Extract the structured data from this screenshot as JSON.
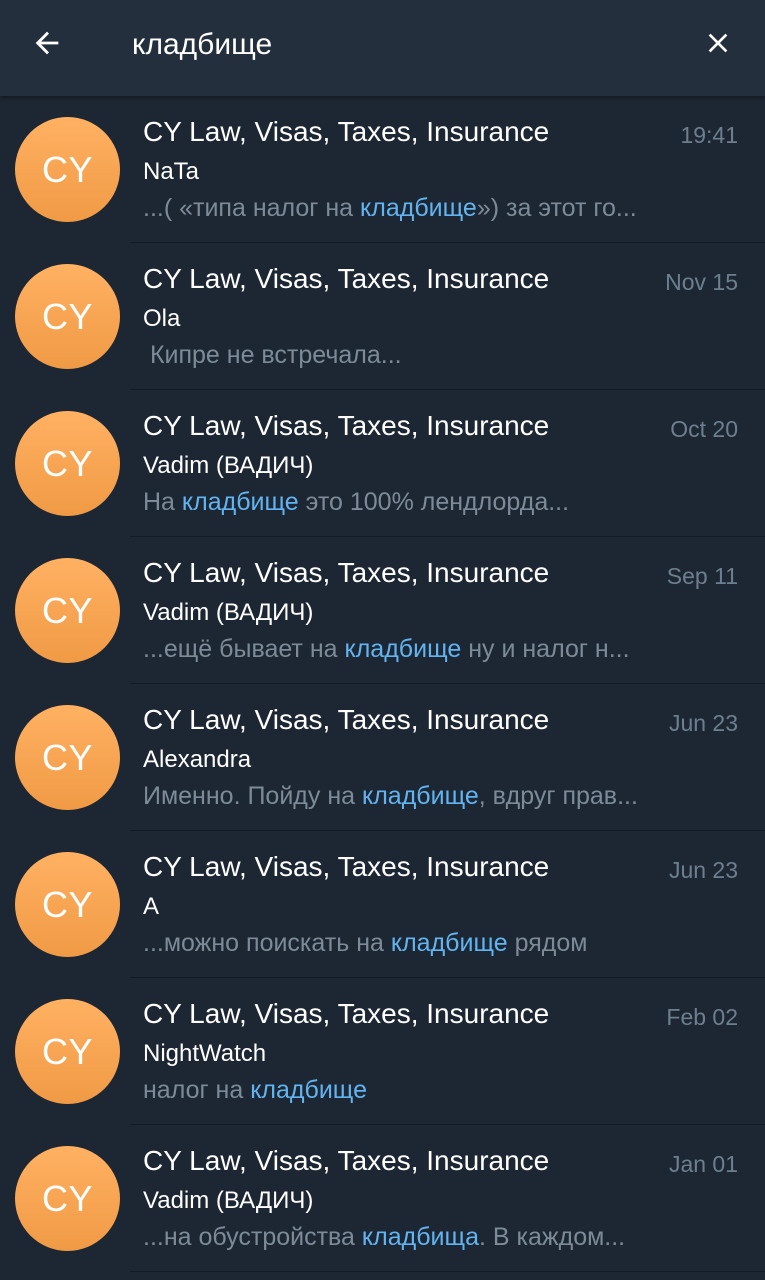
{
  "header": {
    "query": "кладбище",
    "back_icon": "arrow-left-icon",
    "close_icon": "close-icon"
  },
  "colors": {
    "background": "#1d2733",
    "header": "#242f3d",
    "highlight": "#62b4f0",
    "avatar": "#f5a04f"
  },
  "results": [
    {
      "avatar": "CY",
      "title": "CY Law, Visas, Taxes, Insurance",
      "date": "19:41",
      "sender": "NaTa",
      "before": "...( «типа налог на ",
      "highlight": "кладбище",
      "after": "») за этот го..."
    },
    {
      "avatar": "CY",
      "title": "CY Law, Visas, Taxes, Insurance",
      "date": "Nov 15",
      "sender": "Ola",
      "before": " Кипре не встречала...",
      "highlight": "",
      "after": ""
    },
    {
      "avatar": "CY",
      "title": "CY Law, Visas, Taxes, Insurance",
      "date": "Oct 20",
      "sender": "Vadim (ВАДИЧ)",
      "before": "На ",
      "highlight": "кладбище",
      "after": " это 100% лендлорда..."
    },
    {
      "avatar": "CY",
      "title": "CY Law, Visas, Taxes, Insurance",
      "date": "Sep 11",
      "sender": "Vadim (ВАДИЧ)",
      "before": "...ещё бывает на ",
      "highlight": "кладбище",
      "after": " ну и налог н..."
    },
    {
      "avatar": "CY",
      "title": "CY Law, Visas, Taxes, Insurance",
      "date": "Jun 23",
      "sender": "Alexandra",
      "before": "Именно. Пойду на ",
      "highlight": "кладбище",
      "after": ", вдруг прав..."
    },
    {
      "avatar": "CY",
      "title": "CY Law, Visas, Taxes, Insurance",
      "date": "Jun 23",
      "sender": "A",
      "before": "...можно поискать на ",
      "highlight": "кладбище",
      "after": " рядом"
    },
    {
      "avatar": "CY",
      "title": "CY Law, Visas, Taxes, Insurance",
      "date": "Feb 02",
      "sender": "NightWatch",
      "before": "налог на ",
      "highlight": "кладбище",
      "after": ""
    },
    {
      "avatar": "CY",
      "title": "CY Law, Visas, Taxes, Insurance",
      "date": "Jan 01",
      "sender": "Vadim (ВАДИЧ)",
      "before": "...на обустройства ",
      "highlight": "кладбища",
      "after": ". В каждом..."
    }
  ]
}
